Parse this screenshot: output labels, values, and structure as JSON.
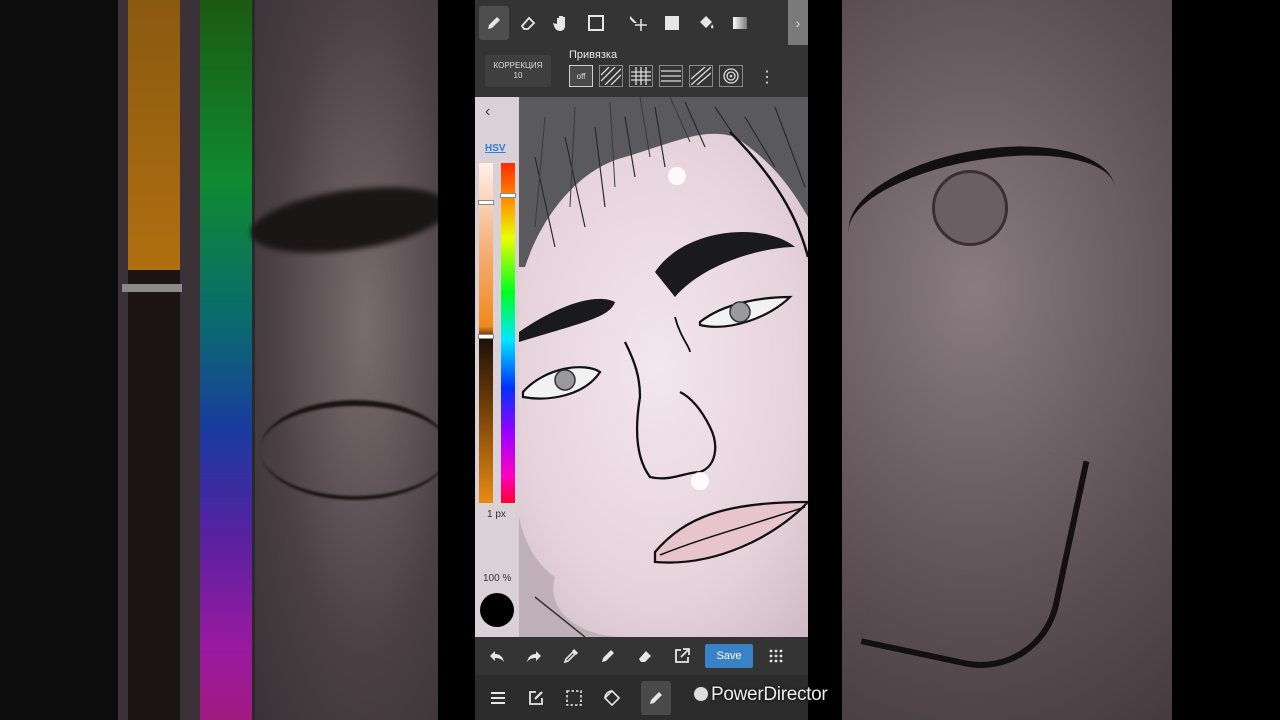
{
  "toolbar": {
    "tools": [
      "pen-icon",
      "eraser-icon",
      "hand-icon",
      "rectangle-icon",
      "move-icon",
      "square-fill-icon",
      "bucket-icon",
      "gradient-icon"
    ]
  },
  "snap": {
    "correction_label": "КОРРЕКЦИЯ",
    "correction_value": "10",
    "snap_title": "Привязка",
    "off_label": "off"
  },
  "palette": {
    "mode": "HSV",
    "brush_size": "1 px",
    "opacity": "100 %",
    "current_color": "#000000"
  },
  "bottom": {
    "save_label": "Save"
  },
  "watermark": {
    "text": "PowerDirector"
  }
}
